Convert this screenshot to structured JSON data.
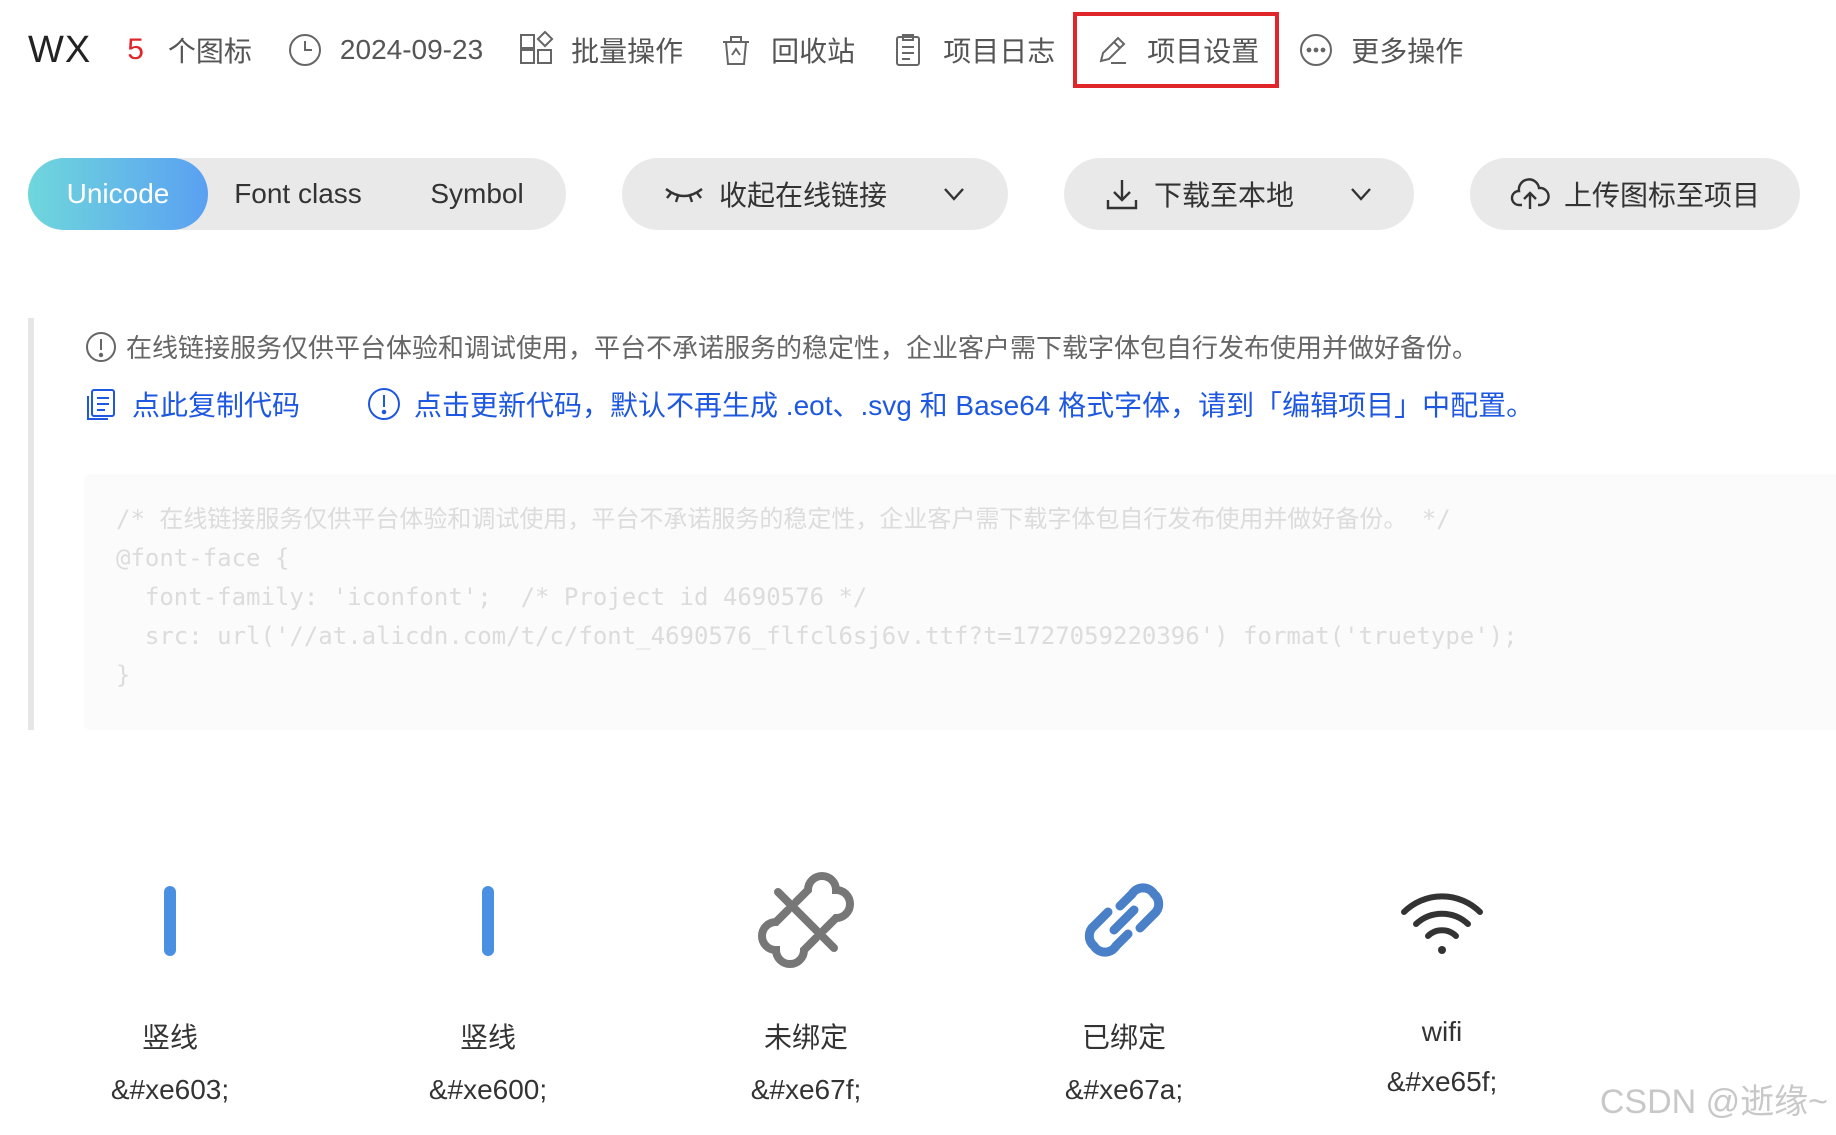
{
  "header": {
    "project_name": "WX",
    "icon_count": "5",
    "icon_count_label": "个图标",
    "date": "2024-09-23",
    "tools": {
      "batch": "批量操作",
      "recycle": "回收站",
      "log": "项目日志",
      "settings": "项目设置",
      "more": "更多操作"
    }
  },
  "tabs": {
    "unicode": "Unicode",
    "font_class": "Font class",
    "symbol": "Symbol"
  },
  "buttons": {
    "collapse_link": "收起在线链接",
    "download": "下载至本地",
    "upload": "上传图标至项目"
  },
  "notice": {
    "info": "在线链接服务仅供平台体验和调试使用，平台不承诺服务的稳定性，企业客户需下载字体包自行发布使用并做好备份。",
    "copy_code": "点此复制代码",
    "update_code": "点击更新代码，默认不再生成 .eot、.svg 和 Base64 格式字体，请到「编辑项目」中配置。"
  },
  "code_lines": [
    "/* 在线链接服务仅供平台体验和调试使用，平台不承诺服务的稳定性，企业客户需下载字体包自行发布使用并做好备份。 */",
    "@font-face {",
    "  font-family: 'iconfont';  /* Project id 4690576 */",
    "  src: url('//at.alicdn.com/t/c/font_4690576_flfcl6sj6v.ttf?t=1727059220396') format('truetype');",
    "}"
  ],
  "icons": [
    {
      "name": "竖线",
      "code": "&#xe603;",
      "icon": "vertical-line-icon"
    },
    {
      "name": "竖线",
      "code": "&#xe600;",
      "icon": "vertical-line-icon"
    },
    {
      "name": "未绑定",
      "code": "&#xe67f;",
      "icon": "unlink-icon"
    },
    {
      "name": "已绑定",
      "code": "&#xe67a;",
      "icon": "link-icon"
    },
    {
      "name": "wifi",
      "code": "&#xe65f;",
      "icon": "wifi-icon"
    }
  ],
  "watermark": "CSDN @逝缘~",
  "colors": {
    "accent_red": "#e0262b",
    "link_blue": "#1f58e0",
    "icon_blue": "#4a90e2",
    "icon_gray": "#777777"
  }
}
